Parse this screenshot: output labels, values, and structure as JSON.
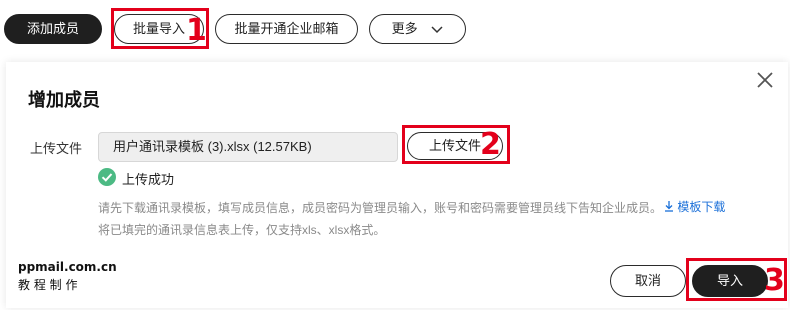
{
  "toolbar": {
    "add_member": "添加成员",
    "bulk_import": "批量导入",
    "bulk_enable_mailbox": "批量开通企业邮箱",
    "more": "更多"
  },
  "annotations": {
    "step1": "1",
    "step2": "2",
    "step3": "3"
  },
  "dialog": {
    "title": "增加成员",
    "upload_label": "上传文件",
    "file_name": "用户通讯录模板 (3).xlsx (12.57KB)",
    "upload_button": "上传文件",
    "success_text": "上传成功",
    "hint_line1": "请先下载通讯录模板，填写成员信息，成员密码为管理员输入，账号和密码需要管理员线下告知企业成员。",
    "template_link": "模板下载",
    "hint_line2": "将已填完的通讯录信息表上传，仅支持xls、xlsx格式。",
    "cancel_button": "取消",
    "import_button": "导入"
  },
  "watermark": {
    "line1": "ppmail.com.cn",
    "line2": "教 程 制 作"
  },
  "colors": {
    "annotation": "#e3001b",
    "success": "#4cba84",
    "link": "#1a6fd8",
    "primary": "#1f1f1f"
  }
}
